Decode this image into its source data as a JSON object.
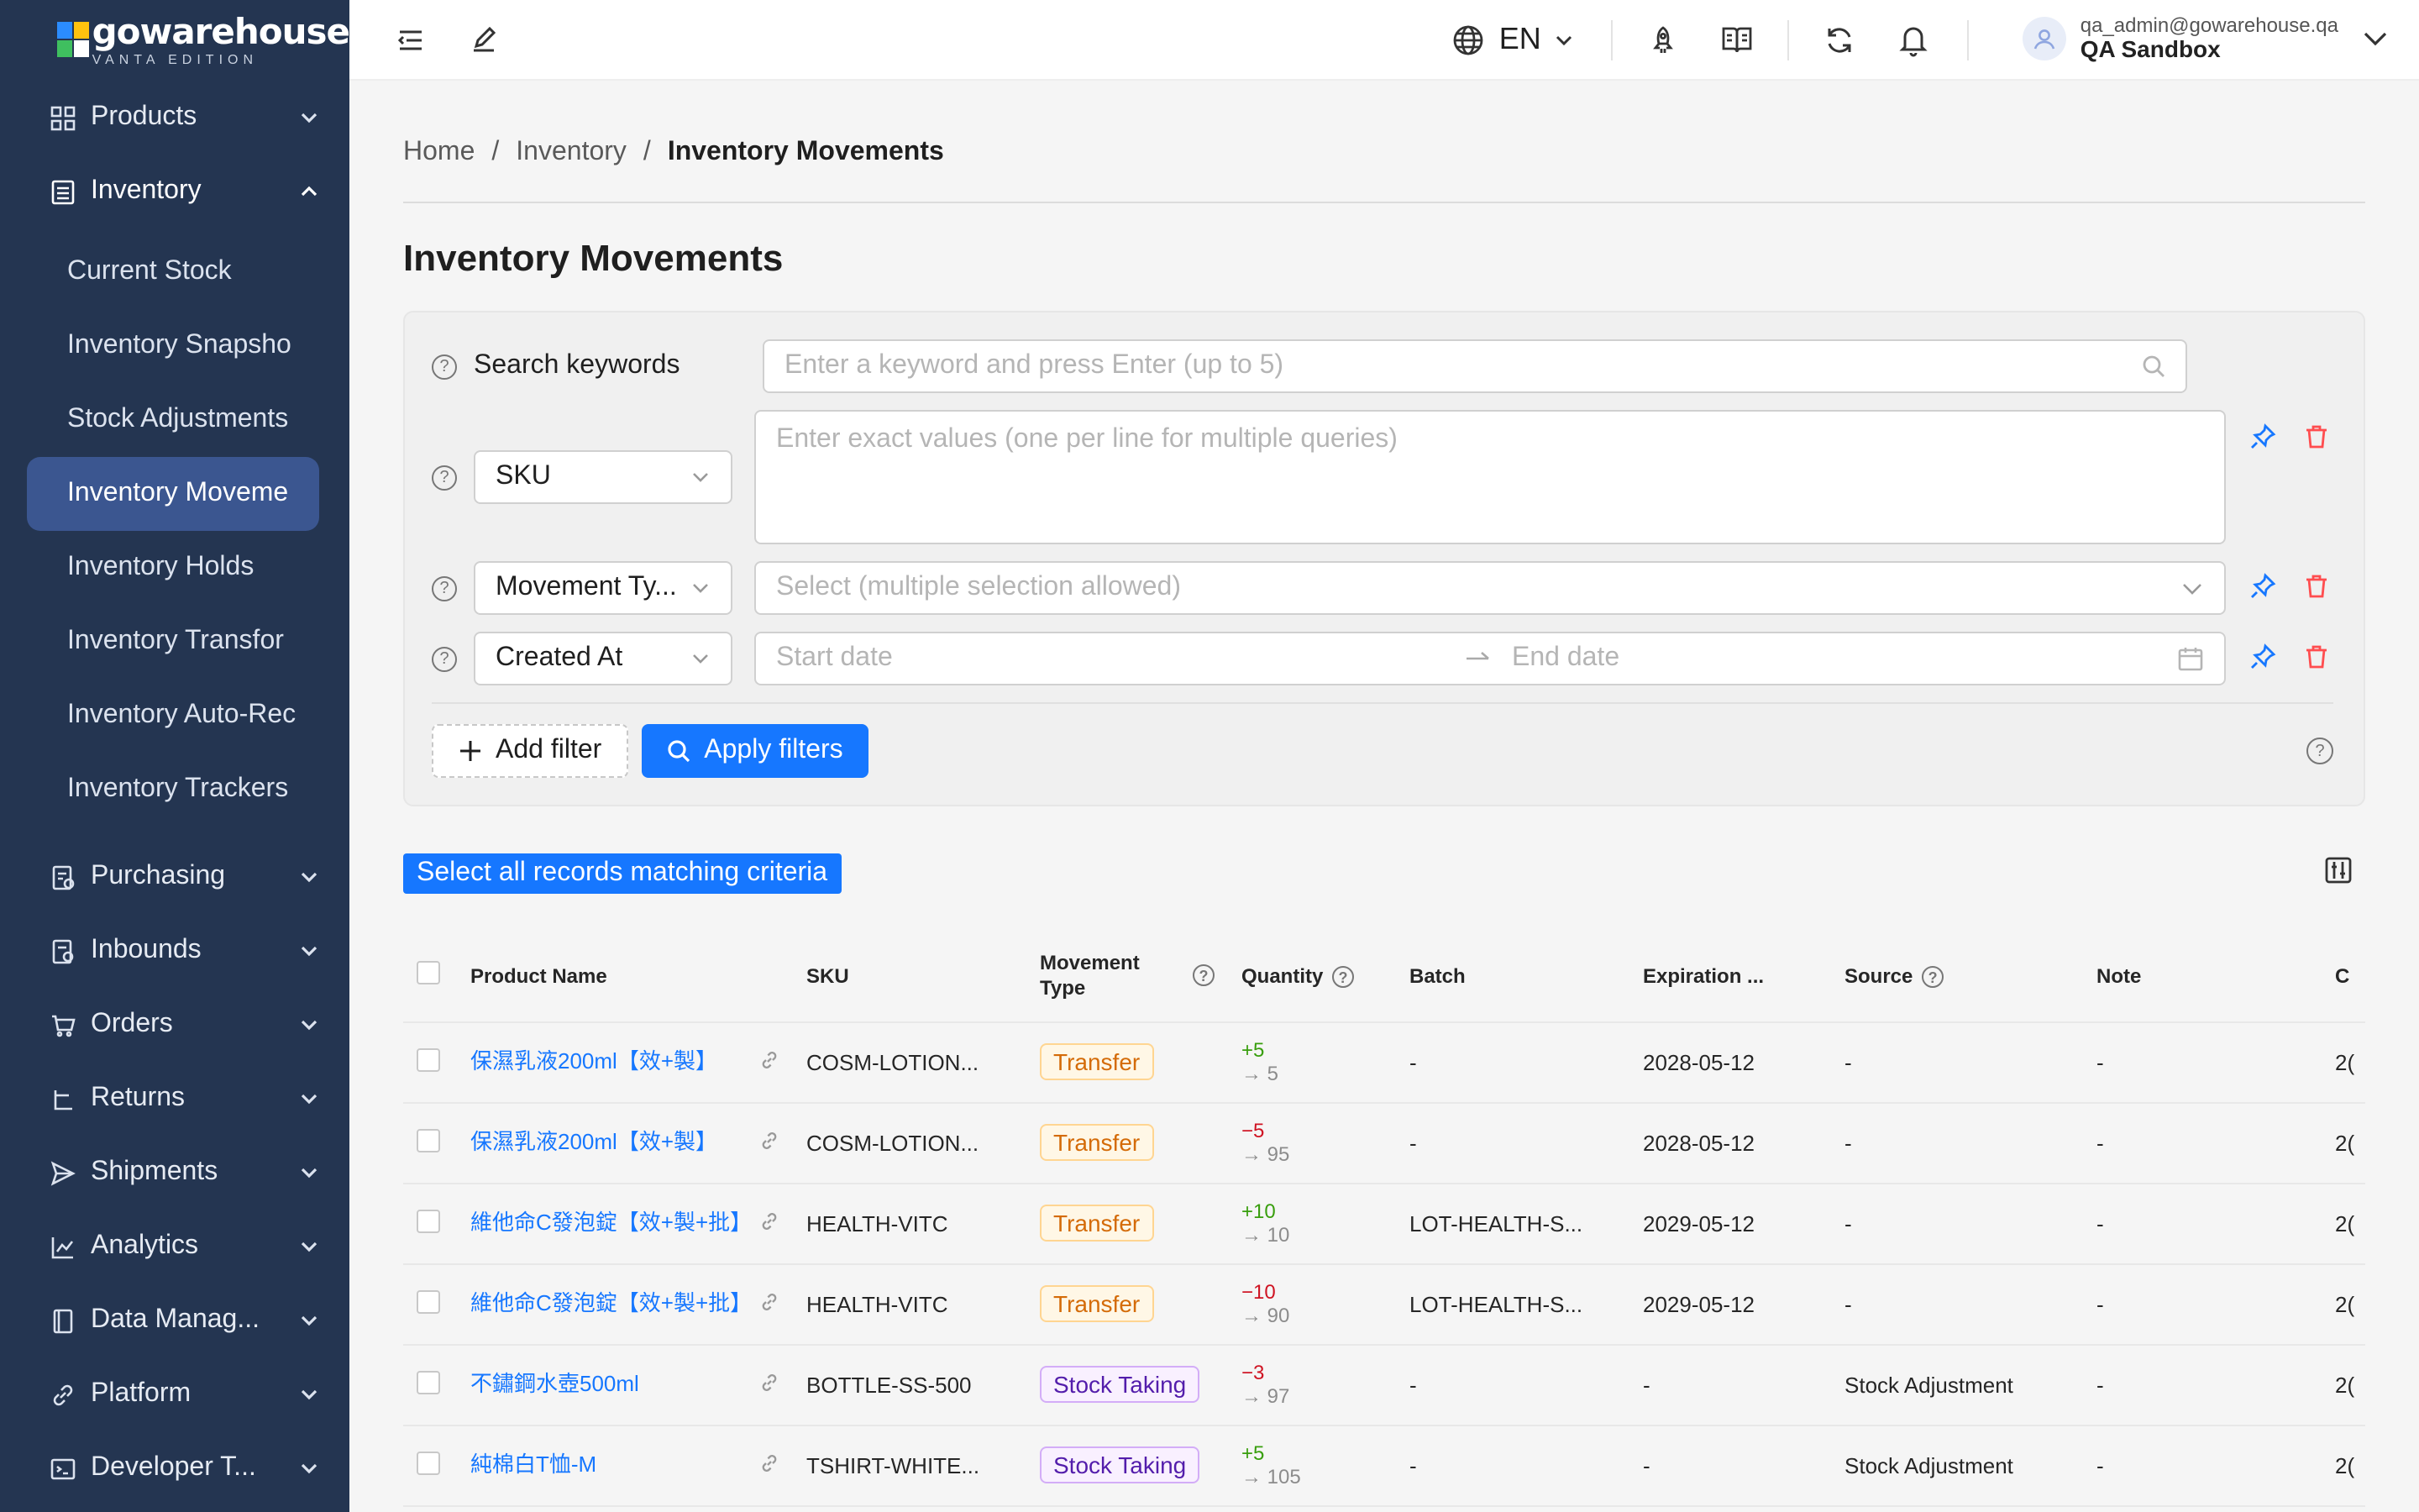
{
  "brand": {
    "title": "gowarehouse",
    "subtitle": "VANTA EDITION"
  },
  "sidebar": {
    "products": "Products",
    "inventory": "Inventory",
    "inventory_sub": [
      "Current Stock",
      "Inventory Snapsho",
      "Stock Adjustments",
      "Inventory Moveme",
      "Inventory Holds",
      "Inventory Transfor",
      "Inventory Auto-Rec",
      "Inventory Trackers"
    ],
    "purchasing": "Purchasing",
    "inbounds": "Inbounds",
    "orders": "Orders",
    "returns": "Returns",
    "shipments": "Shipments",
    "analytics": "Analytics",
    "data": "Data Manag...",
    "platform": "Platform",
    "developer": "Developer T..."
  },
  "topbar": {
    "lang": "EN",
    "user_email": "qa_admin@gowarehouse.qa",
    "user_org": "QA Sandbox"
  },
  "breadcrumb": {
    "home": "Home",
    "inventory": "Inventory",
    "current": "Inventory Movements",
    "sep": "/"
  },
  "page_title": "Inventory Movements",
  "filters": {
    "search_label": "Search keywords",
    "search_placeholder": "Enter a keyword and press Enter (up to 5)",
    "sku_field": "SKU",
    "sku_placeholder": "Enter exact values (one per line for multiple queries)",
    "movement_field": "Movement Ty...",
    "movement_placeholder": "Select (multiple selection allowed)",
    "created_field": "Created At",
    "start_placeholder": "Start date",
    "end_placeholder": "End date",
    "add_filter": "Add filter",
    "apply": "Apply filters"
  },
  "select_all": "Select all records matching criteria",
  "table": {
    "headers": {
      "product": "Product Name",
      "sku": "SKU",
      "movement_1": "Movement",
      "movement_2": "Type",
      "quantity": "Quantity",
      "batch": "Batch",
      "expiration": "Expiration ...",
      "source": "Source",
      "note": "Note",
      "last": "C"
    },
    "rows": [
      {
        "name": "保濕乳液200ml【效+製】",
        "sku": "COSM-LOTION...",
        "type": "Transfer",
        "delta": "+5",
        "after": "→ 5",
        "batch": "-",
        "exp": "2028-05-12",
        "source": "-",
        "note": "-",
        "last": "2("
      },
      {
        "name": "保濕乳液200ml【效+製】",
        "sku": "COSM-LOTION...",
        "type": "Transfer",
        "delta": "−5",
        "after": "→ 95",
        "batch": "-",
        "exp": "2028-05-12",
        "source": "-",
        "note": "-",
        "last": "2("
      },
      {
        "name": "維他命C發泡錠【效+製+批】",
        "sku": "HEALTH-VITC",
        "type": "Transfer",
        "delta": "+10",
        "after": "→ 10",
        "batch": "LOT-HEALTH-S...",
        "exp": "2029-05-12",
        "source": "-",
        "note": "-",
        "last": "2("
      },
      {
        "name": "維他命C發泡錠【效+製+批】",
        "sku": "HEALTH-VITC",
        "type": "Transfer",
        "delta": "−10",
        "after": "→ 90",
        "batch": "LOT-HEALTH-S...",
        "exp": "2029-05-12",
        "source": "-",
        "note": "-",
        "last": "2("
      },
      {
        "name": "不鏽鋼水壺500ml",
        "sku": "BOTTLE-SS-500",
        "type": "Stock Taking",
        "delta": "−3",
        "after": "→ 97",
        "batch": "-",
        "exp": "-",
        "source": "Stock Adjustment",
        "note": "-",
        "last": "2("
      },
      {
        "name": "純棉白T恤-M",
        "sku": "TSHIRT-WHITE...",
        "type": "Stock Taking",
        "delta": "+5",
        "after": "→ 105",
        "batch": "-",
        "exp": "-",
        "source": "Stock Adjustment",
        "note": "-",
        "last": "2("
      }
    ]
  }
}
